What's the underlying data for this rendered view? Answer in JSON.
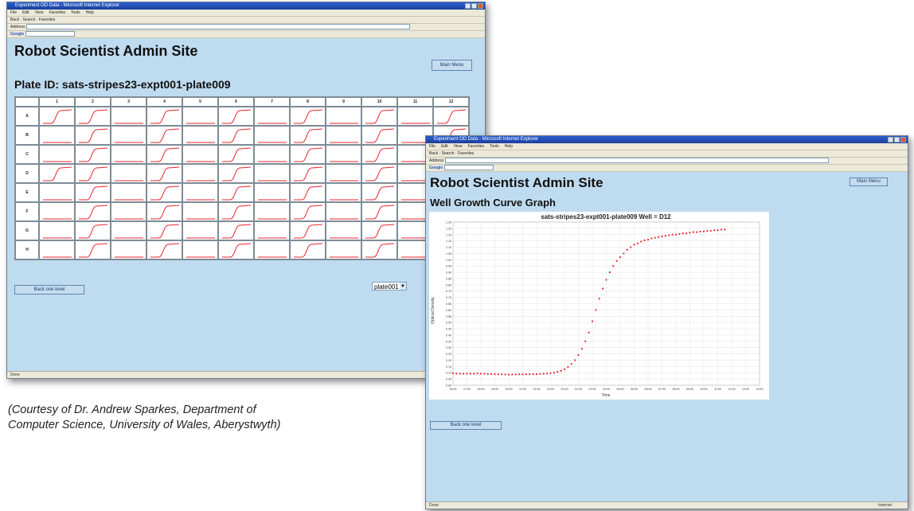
{
  "window1": {
    "title": "Experiment OD Data - Microsoft Internet Explorer",
    "menu": [
      "File",
      "Edit",
      "View",
      "Favorites",
      "Tools",
      "Help"
    ],
    "toolbar_text": "Back · Search · Favorites",
    "address_label": "Address",
    "address_value": "http://...",
    "google_label": "Google",
    "site_title": "Robot Scientist Admin Site",
    "main_menu": "Main Menu",
    "plate_heading": "Plate ID: sats-stripes23-expt001-plate009",
    "columns": [
      "1",
      "2",
      "3",
      "4",
      "5",
      "6",
      "7",
      "8",
      "9",
      "10",
      "11",
      "12"
    ],
    "rows": [
      {
        "label": "A",
        "growth": [
          1,
          1,
          0,
          1,
          0,
          1,
          0,
          1,
          0,
          1,
          0,
          1
        ]
      },
      {
        "label": "B",
        "growth": [
          0,
          1,
          0,
          1,
          0,
          1,
          0,
          1,
          0,
          1,
          0,
          1
        ]
      },
      {
        "label": "C",
        "growth": [
          0,
          1,
          0,
          1,
          0,
          1,
          0,
          1,
          0,
          1,
          0,
          1
        ]
      },
      {
        "label": "D",
        "growth": [
          1,
          1,
          0,
          1,
          0,
          1,
          0,
          1,
          0,
          1,
          0,
          1
        ]
      },
      {
        "label": "E",
        "growth": [
          0,
          1,
          0,
          1,
          0,
          1,
          0,
          1,
          0,
          1,
          0,
          1
        ]
      },
      {
        "label": "F",
        "growth": [
          0,
          1,
          0,
          1,
          0,
          1,
          0,
          1,
          0,
          1,
          0,
          1
        ]
      },
      {
        "label": "G",
        "growth": [
          0,
          1,
          0,
          1,
          0,
          1,
          0,
          1,
          0,
          1,
          0,
          1
        ]
      },
      {
        "label": "H",
        "growth": [
          0,
          1,
          0,
          1,
          0,
          1,
          0,
          1,
          0,
          1,
          0,
          1
        ]
      }
    ],
    "back_button": "Back one level",
    "plate_select": "plate001",
    "status": "Done"
  },
  "window2": {
    "title": "Experiment OD Data - Microsoft Internet Explorer",
    "menu": [
      "File",
      "Edit",
      "View",
      "Favorites",
      "Tools",
      "Help"
    ],
    "toolbar_text": "Back · Search · Favorites",
    "address_label": "Address",
    "address_value": "http://...",
    "google_label": "Google",
    "site_title": "Robot Scientist Admin Site",
    "main_menu": "Main Menu",
    "graph_heading": "Well Growth Curve Graph",
    "back_button": "Back one level",
    "status": "Done",
    "status_zone": "Internet"
  },
  "caption": {
    "line1": "(Courtesy of Dr. Andrew Sparkes, Department of",
    "line2": "Computer Science, University of Wales, Aberystwyth)"
  },
  "chart_data": {
    "type": "scatter",
    "title": "sats-stripes23-expt001-plate009  Well = D12",
    "xlabel": "Time",
    "ylabel": "Optical Density",
    "ylim": [
      0,
      1.3
    ],
    "y_ticks": [
      "0.00",
      "0.05",
      "0.10",
      "0.15",
      "0.20",
      "0.25",
      "0.30",
      "0.35",
      "0.40",
      "0.45",
      "0.50",
      "0.55",
      "0.60",
      "0.65",
      "0.70",
      "0.75",
      "0.80",
      "0.85",
      "0.90",
      "0.95",
      "1.00",
      "1.05",
      "1.10",
      "1.15",
      "1.20",
      "1.25",
      "1.30"
    ],
    "x_ticks": [
      "16:00",
      "17:00",
      "18:00",
      "19:00",
      "20:00",
      "21:00",
      "22:00",
      "23:00",
      "00:00",
      "01:00",
      "02:00",
      "03:00",
      "04:00",
      "05:00",
      "06:00",
      "07:00",
      "08:00",
      "09:00",
      "10:00",
      "11:00",
      "12:00",
      "13:00",
      "14:00"
    ],
    "marker_color": "#e8242e",
    "grid": true,
    "series": [
      {
        "hours": [
          0,
          0.5,
          1,
          1.5,
          2,
          2.5,
          3,
          3.5,
          4,
          4.5,
          5,
          5.5,
          6,
          6.5,
          7,
          7.5,
          8,
          8.5,
          9,
          9.5,
          10,
          10.5,
          11,
          11.5,
          12,
          12.5,
          13,
          13.5,
          14,
          14.5,
          15,
          15.5,
          16,
          16.5,
          17,
          17.5,
          18,
          18.5,
          19,
          19.5,
          20,
          20.5,
          21,
          21.5,
          22,
          22.5,
          23,
          23.5,
          24,
          24.5,
          25,
          25.5,
          26,
          26.5,
          27,
          27.5,
          28,
          28.5,
          29,
          29.5,
          30,
          30.5,
          31,
          31.5,
          32,
          32.5,
          33,
          33.5,
          34,
          34.5,
          35,
          35.5,
          36,
          36.5,
          37,
          37.5,
          38,
          38.5,
          39
        ],
        "values": [
          0.095,
          0.093,
          0.092,
          0.091,
          0.093,
          0.092,
          0.092,
          0.094,
          0.092,
          0.092,
          0.09,
          0.089,
          0.088,
          0.087,
          0.087,
          0.086,
          0.085,
          0.086,
          0.086,
          0.087,
          0.087,
          0.087,
          0.088,
          0.088,
          0.089,
          0.09,
          0.091,
          0.093,
          0.096,
          0.1,
          0.106,
          0.115,
          0.127,
          0.145,
          0.17,
          0.2,
          0.24,
          0.29,
          0.35,
          0.42,
          0.51,
          0.6,
          0.69,
          0.77,
          0.84,
          0.9,
          0.95,
          0.99,
          1.02,
          1.05,
          1.08,
          1.1,
          1.12,
          1.13,
          1.145,
          1.155,
          1.16,
          1.17,
          1.175,
          1.18,
          1.185,
          1.19,
          1.195,
          1.2,
          1.2,
          1.205,
          1.21,
          1.21,
          1.215,
          1.22,
          1.22,
          1.225,
          1.225,
          1.23,
          1.23,
          1.235,
          1.235,
          1.24,
          1.24
        ]
      }
    ]
  }
}
